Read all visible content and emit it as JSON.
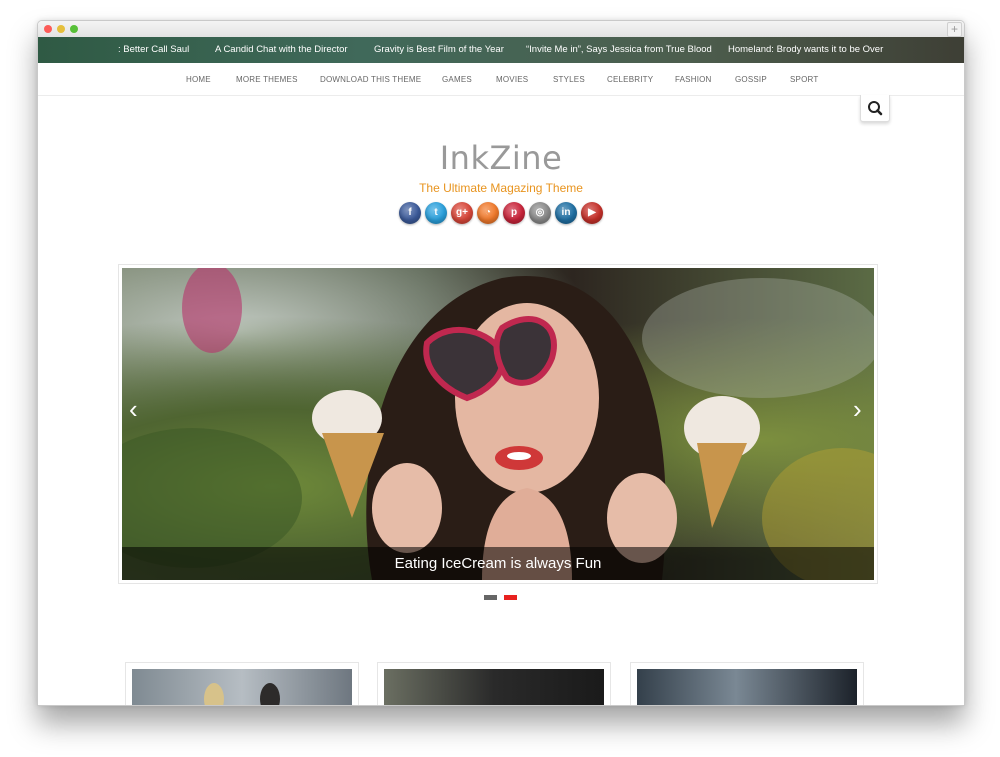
{
  "ticker": [
    ": Better Call Saul",
    "A Candid Chat with the Director",
    "Gravity is Best Film of the Year",
    "“Invite Me in”, Says Jessica from True Blood",
    "Homeland: Brody wants it to be Over"
  ],
  "nav": [
    "HOME",
    "MORE THEMES",
    "DOWNLOAD THIS THEME",
    "GAMES",
    "MOVIES",
    "STYLES",
    "CELEBRITY",
    "FASHION",
    "GOSSIP",
    "SPORT"
  ],
  "brand": {
    "title": "InkZine",
    "tagline": "The Ultimate Magazing Theme"
  },
  "social": [
    {
      "name": "facebook-icon",
      "glyph": "f",
      "color": "#3b5a9a"
    },
    {
      "name": "twitter-icon",
      "glyph": "t",
      "color": "#2aa0dc"
    },
    {
      "name": "google-plus-icon",
      "glyph": "g+",
      "color": "#d8473a"
    },
    {
      "name": "rss-icon",
      "glyph": "◔",
      "color": "#f0792b"
    },
    {
      "name": "pinterest-icon",
      "glyph": "p",
      "color": "#c9243a"
    },
    {
      "name": "instagram-icon",
      "glyph": "◎",
      "color": "#8a8a8a"
    },
    {
      "name": "linkedin-icon",
      "glyph": "in",
      "color": "#1f6fa3"
    },
    {
      "name": "youtube-icon",
      "glyph": "▶",
      "color": "#c5302a"
    }
  ],
  "slider": {
    "caption": "Eating IceCream is always Fun",
    "active_dot": 2,
    "dot_count": 2
  },
  "colors": {
    "accent": "#e8941f",
    "dot_active": "#e8211f",
    "dot_inactive": "#666666"
  }
}
